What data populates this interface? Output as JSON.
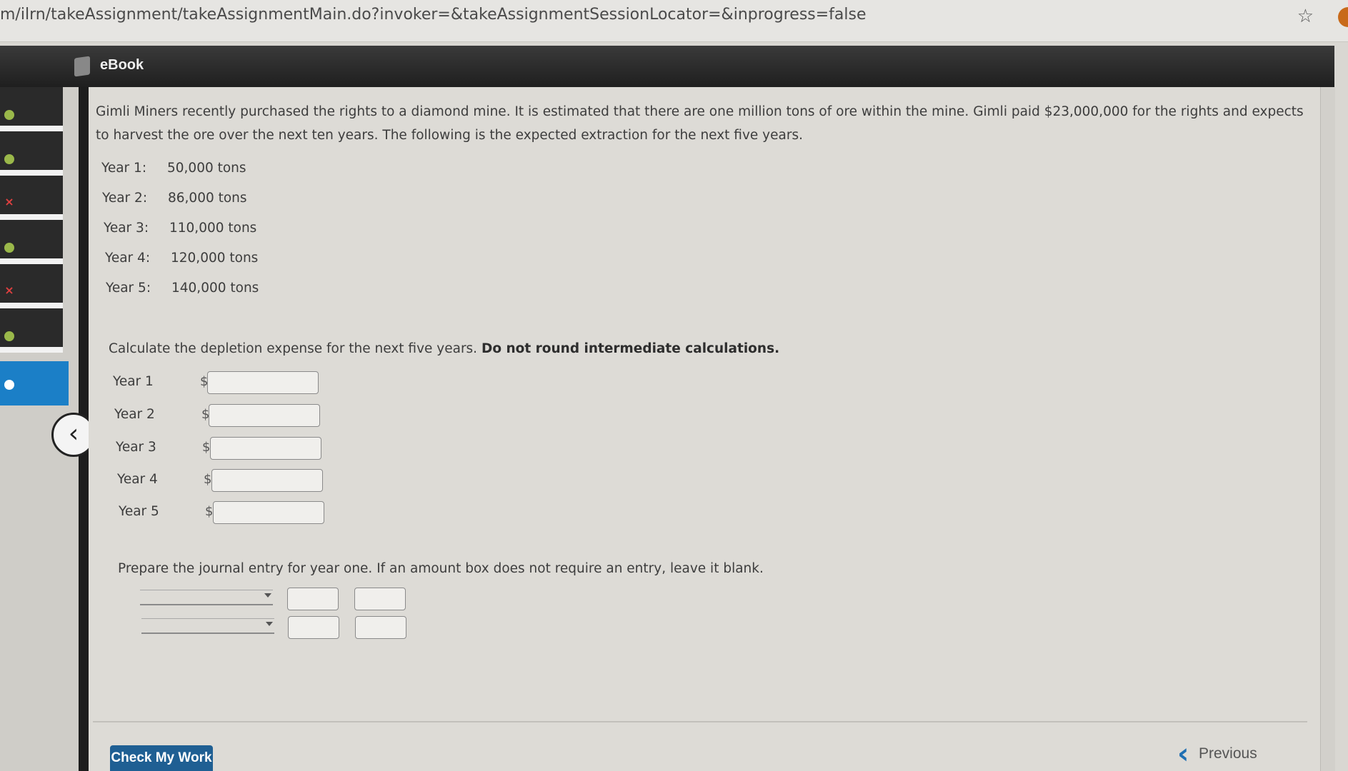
{
  "browser": {
    "url": "m/ilrn/takeAssignment/takeAssignmentMain.do?invoker=&takeAssignmentSessionLocator=&inprogress=false"
  },
  "header": {
    "ebook_label": "eBook"
  },
  "problem": {
    "intro": "Gimli Miners recently purchased the rights to a diamond mine. It is estimated that there are one million tons of ore within the mine. Gimli paid $23,000,000 for the rights and expects to harvest the ore over the next ten years. The following is the expected extraction for the next five years.",
    "extraction": [
      {
        "label": "Year 1:",
        "tons": "50,000 tons"
      },
      {
        "label": "Year 2:",
        "tons": "86,000 tons"
      },
      {
        "label": "Year 3:",
        "tons": "110,000 tons"
      },
      {
        "label": "Year 4:",
        "tons": "120,000 tons"
      },
      {
        "label": "Year 5:",
        "tons": "140,000 tons"
      }
    ],
    "instruction_plain": "Calculate the depletion expense for the next five years.",
    "instruction_bold": "Do not round intermediate calculations.",
    "depletion": [
      {
        "label": "Year 1",
        "currency": "$",
        "value": ""
      },
      {
        "label": "Year 2",
        "currency": "$",
        "value": ""
      },
      {
        "label": "Year 3",
        "currency": "$",
        "value": ""
      },
      {
        "label": "Year 4",
        "currency": "$",
        "value": ""
      },
      {
        "label": "Year 5",
        "currency": "$",
        "value": ""
      }
    ],
    "journal_instruction": "Prepare the journal entry for year one. If an amount box does not require an entry, leave it blank."
  },
  "footer": {
    "check_label": "Check My Work",
    "previous_label": "Previous"
  },
  "colors": {
    "accent": "#1b7fc7",
    "button": "#1f5f93",
    "correct": "#9ab84a",
    "incorrect": "#e04040"
  }
}
